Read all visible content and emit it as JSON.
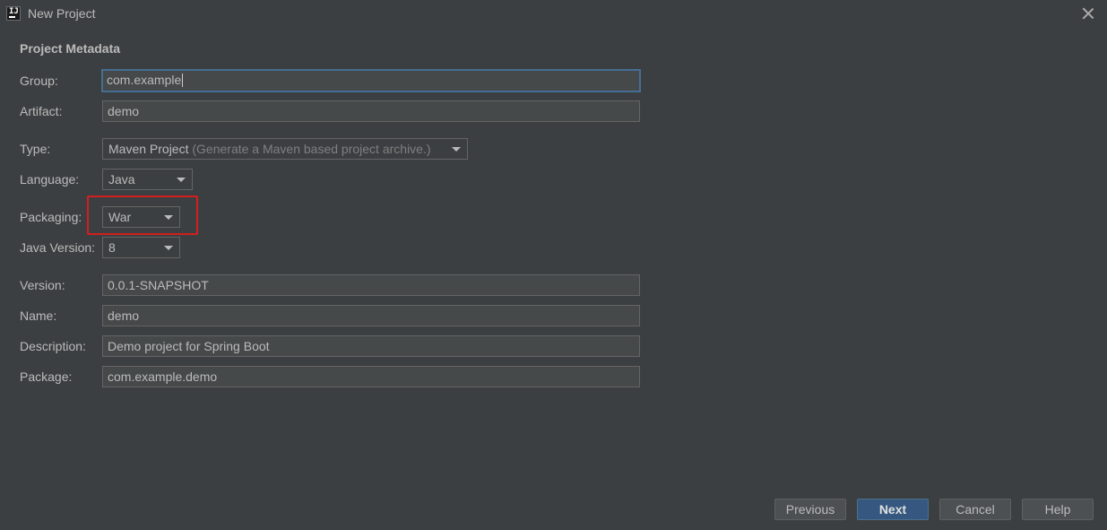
{
  "window": {
    "title": "New Project",
    "app_icon": "intellij-icon"
  },
  "section": {
    "title": "Project Metadata"
  },
  "fields": {
    "group": {
      "label": "Group:",
      "value": "com.example"
    },
    "artifact": {
      "label": "Artifact:",
      "value": "demo"
    },
    "type": {
      "label": "Type:",
      "value": "Maven Project",
      "hint": "(Generate a Maven based project archive.)"
    },
    "language": {
      "label": "Language:",
      "value": "Java"
    },
    "packaging": {
      "label": "Packaging:",
      "value": "War"
    },
    "java_version": {
      "label": "Java Version:",
      "value": "8"
    },
    "version": {
      "label": "Version:",
      "value": "0.0.1-SNAPSHOT"
    },
    "name": {
      "label": "Name:",
      "value": "demo"
    },
    "description": {
      "label": "Description:",
      "value": "Demo project for Spring Boot"
    },
    "package": {
      "label": "Package:",
      "value": "com.example.demo"
    }
  },
  "buttons": {
    "previous": "Previous",
    "next": "Next",
    "cancel": "Cancel",
    "help": "Help"
  },
  "colors": {
    "background": "#3c3f41",
    "focus_border": "#466d94",
    "highlight": "#d21e1e",
    "primary_button": "#365880"
  }
}
